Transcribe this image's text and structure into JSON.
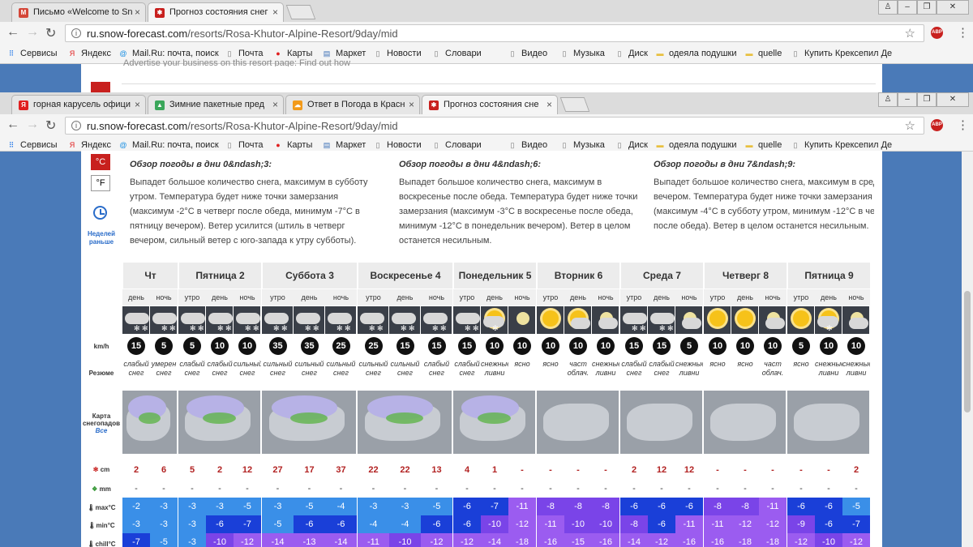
{
  "browser_back": {
    "tabs": [
      {
        "title": "Письмо «Welcome to Sn",
        "icon": "gmail-icon",
        "color": "#d44638"
      },
      {
        "title": "Прогноз состояния снег",
        "icon": "snowforecast-icon",
        "color": "#c8201e"
      }
    ],
    "url_host": "ru.snow-forecast.com",
    "url_path": "/resorts/Rosa-Khutor-Alpine-Resort/9day/mid",
    "page_strip_text": "Advertise your business on this resort page:  Find out how"
  },
  "browser_front": {
    "tabs": [
      {
        "title": "горная карусель офици",
        "icon": "yandex-icon",
        "color": "#e02020"
      },
      {
        "title": "Зимние пакетные пред",
        "icon": "drive-icon",
        "color": "#3aa65a"
      },
      {
        "title": "Ответ в Погода в Красн",
        "icon": "weather-icon",
        "color": "#f29a1a"
      },
      {
        "title": "Прогноз состояния сне",
        "icon": "snowforecast-icon",
        "color": "#c8201e"
      }
    ],
    "url_host": "ru.snow-forecast.com",
    "url_path": "/resorts/Rosa-Khutor-Alpine-Resort/9day/mid"
  },
  "bookmarks": [
    {
      "label": "Сервисы",
      "icon": "apps-grid-icon"
    },
    {
      "label": "Яндекс",
      "icon": "yandex-icon"
    },
    {
      "label": "Mail.Ru: почта, поиск",
      "icon": "mailru-icon"
    },
    {
      "label": "Почта",
      "icon": "page-icon"
    },
    {
      "label": "Карты",
      "icon": "map-pin-icon"
    },
    {
      "label": "Маркет",
      "icon": "market-icon"
    },
    {
      "label": "Новости",
      "icon": "page-icon"
    },
    {
      "label": "Словари",
      "icon": "page-icon"
    },
    {
      "label": "Видео",
      "icon": "page-icon"
    },
    {
      "label": "Музыка",
      "icon": "page-icon"
    },
    {
      "label": "Диск",
      "icon": "page-icon"
    },
    {
      "label": "одеяла подушки",
      "icon": "folder-icon"
    },
    {
      "label": "quelle",
      "icon": "folder-icon"
    },
    {
      "label": "Купить Крексепил Де",
      "icon": "page-icon"
    }
  ],
  "sidebar": {
    "unit_c": "°C",
    "unit_f": "°F",
    "prev_week": "Неделей раньше"
  },
  "row_labels": {
    "wind": "km/h",
    "summary": "Резюме",
    "map": "Карта снегопадов",
    "map_sub": "Все",
    "snow": "cm",
    "rain": "mm",
    "max": "max°C",
    "min": "min°C",
    "chill": "chill°C"
  },
  "summaries": [
    {
      "title": "Обзор погоды в дни 0&ndash;3:",
      "text": "Выпадет большое количество снега, максимум в субботу утром. Температура будет ниже точки замерзания (максимум -2°C в четверг после обеда, минимум -7°C в пятницу вечером). Ветер усилится (штиль в четверг вечером, сильный ветер с юго-запада к утру субботы)."
    },
    {
      "title": "Обзор погоды в дни 4&ndash;6:",
      "text": "Выпадет большое количество снега, максимум в воскресенье после обеда. Температура будет ниже точки замерзания (максимум -3°C в воскресенье после обеда, минимум -12°C в понедельник вечером). Ветер в целом останется несильным."
    },
    {
      "title": "Обзор погоды в дни 7&ndash;9:",
      "text": "Выпадет большое количество снега, максимум в среду вечером. Температура будет ниже точки замерзания (максимум -4°C в субботу утром, минимум -12°C в четверг после обеда). Ветер в целом останется несильным."
    }
  ],
  "days": [
    {
      "name": "Чт",
      "periods": [
        {
          "tod": "день",
          "wx": "snow",
          "wind": "15",
          "summary": "слабый снег",
          "snow": "2",
          "rain": "-",
          "max": "-2",
          "min": "-3",
          "chill": "-7"
        },
        {
          "tod": "ночь",
          "wx": "snow",
          "wind": "5",
          "summary": "умерен снег",
          "snow": "6",
          "rain": "-",
          "max": "-3",
          "min": "-3",
          "chill": "-5"
        }
      ]
    },
    {
      "name": "Пятница 2",
      "periods": [
        {
          "tod": "утро",
          "wx": "snow",
          "wind": "5",
          "summary": "слабый снег",
          "snow": "5",
          "rain": "-",
          "max": "-3",
          "min": "-3",
          "chill": "-3"
        },
        {
          "tod": "день",
          "wx": "snow",
          "wind": "10",
          "summary": "слабый снег",
          "snow": "2",
          "rain": "-",
          "max": "-3",
          "min": "-6",
          "chill": "-10"
        },
        {
          "tod": "ночь",
          "wx": "snow",
          "wind": "10",
          "summary": "сильный снег",
          "snow": "12",
          "rain": "-",
          "max": "-5",
          "min": "-7",
          "chill": "-12"
        }
      ]
    },
    {
      "name": "Суббота 3",
      "periods": [
        {
          "tod": "утро",
          "wx": "snow",
          "wind": "35",
          "summary": "сильный снег",
          "snow": "27",
          "rain": "-",
          "max": "-3",
          "min": "-5",
          "chill": "-14"
        },
        {
          "tod": "день",
          "wx": "snow",
          "wind": "35",
          "summary": "сильный снег",
          "snow": "17",
          "rain": "-",
          "max": "-5",
          "min": "-6",
          "chill": "-13"
        },
        {
          "tod": "ночь",
          "wx": "snow",
          "wind": "25",
          "summary": "сильный снег",
          "snow": "37",
          "rain": "-",
          "max": "-4",
          "min": "-6",
          "chill": "-14"
        }
      ]
    },
    {
      "name": "Воскресенье 4",
      "periods": [
        {
          "tod": "утро",
          "wx": "snow",
          "wind": "25",
          "summary": "сильный снег",
          "snow": "22",
          "rain": "-",
          "max": "-3",
          "min": "-4",
          "chill": "-11"
        },
        {
          "tod": "день",
          "wx": "snow",
          "wind": "15",
          "summary": "сильный снег",
          "snow": "22",
          "rain": "-",
          "max": "-3",
          "min": "-4",
          "chill": "-10"
        },
        {
          "tod": "ночь",
          "wx": "snow",
          "wind": "15",
          "summary": "слабый снег",
          "snow": "13",
          "rain": "-",
          "max": "-5",
          "min": "-6",
          "chill": "-12"
        }
      ]
    },
    {
      "name": "Понедельник 5",
      "periods": [
        {
          "tod": "утро",
          "wx": "snow",
          "wind": "15",
          "summary": "слабый снег",
          "snow": "4",
          "rain": "-",
          "max": "-6",
          "min": "-6",
          "chill": "-12"
        },
        {
          "tod": "день",
          "wx": "sunsnow",
          "wind": "10",
          "summary": "снежные ливни",
          "snow": "1",
          "rain": "-",
          "max": "-7",
          "min": "-10",
          "chill": "-14"
        },
        {
          "tod": "ночь",
          "wx": "moon",
          "wind": "10",
          "summary": "ясно",
          "snow": "-",
          "rain": "-",
          "max": "-11",
          "min": "-12",
          "chill": "-18"
        }
      ]
    },
    {
      "name": "Вторник 6",
      "periods": [
        {
          "tod": "утро",
          "wx": "sun",
          "wind": "10",
          "summary": "ясно",
          "snow": "-",
          "rain": "-",
          "max": "-8",
          "min": "-11",
          "chill": "-16"
        },
        {
          "tod": "день",
          "wx": "suncloud",
          "wind": "10",
          "summary": "част облач.",
          "snow": "-",
          "rain": "-",
          "max": "-8",
          "min": "-10",
          "chill": "-15"
        },
        {
          "tod": "ночь",
          "wx": "mooncloud",
          "wind": "10",
          "summary": "снежные ливни",
          "snow": "-",
          "rain": "-",
          "max": "-8",
          "min": "-10",
          "chill": "-16"
        }
      ]
    },
    {
      "name": "Среда 7",
      "periods": [
        {
          "tod": "утро",
          "wx": "snow",
          "wind": "15",
          "summary": "слабый снег",
          "snow": "2",
          "rain": "-",
          "max": "-6",
          "min": "-8",
          "chill": "-14"
        },
        {
          "tod": "день",
          "wx": "snow",
          "wind": "15",
          "summary": "слабый снег",
          "snow": "12",
          "rain": "-",
          "max": "-6",
          "min": "-6",
          "chill": "-12"
        },
        {
          "tod": "ночь",
          "wx": "mooncloud",
          "wind": "5",
          "summary": "снежные ливни",
          "snow": "12",
          "rain": "-",
          "max": "-6",
          "min": "-11",
          "chill": "-16"
        }
      ]
    },
    {
      "name": "Четверг 8",
      "periods": [
        {
          "tod": "утро",
          "wx": "sun",
          "wind": "10",
          "summary": "ясно",
          "snow": "-",
          "rain": "-",
          "max": "-8",
          "min": "-11",
          "chill": "-16"
        },
        {
          "tod": "день",
          "wx": "sun",
          "wind": "10",
          "summary": "ясно",
          "snow": "-",
          "rain": "-",
          "max": "-8",
          "min": "-12",
          "chill": "-18"
        },
        {
          "tod": "ночь",
          "wx": "mooncloud",
          "wind": "10",
          "summary": "част облач.",
          "snow": "-",
          "rain": "-",
          "max": "-11",
          "min": "-12",
          "chill": "-18"
        }
      ]
    },
    {
      "name": "Пятница 9",
      "periods": [
        {
          "tod": "утро",
          "wx": "sun",
          "wind": "5",
          "summary": "ясно",
          "snow": "-",
          "rain": "-",
          "max": "-6",
          "min": "-9",
          "chill": "-12"
        },
        {
          "tod": "день",
          "wx": "sunsnow",
          "wind": "10",
          "summary": "снежные ливни",
          "snow": "-",
          "rain": "-",
          "max": "-6",
          "min": "-6",
          "chill": "-10"
        },
        {
          "tod": "ночь",
          "wx": "mooncloud",
          "wind": "10",
          "summary": "снежные ливни",
          "snow": "2",
          "rain": "-",
          "max": "-5",
          "min": "-7",
          "chill": "-12"
        }
      ]
    }
  ],
  "colors": {
    "accent": "#c8201e",
    "link": "#2a6cc9",
    "temp_blue": "#3a8fe8",
    "temp_dark": "#1a3fd8",
    "temp_purple": "#9b5cf0",
    "temp_violet": "#7a44e8"
  }
}
